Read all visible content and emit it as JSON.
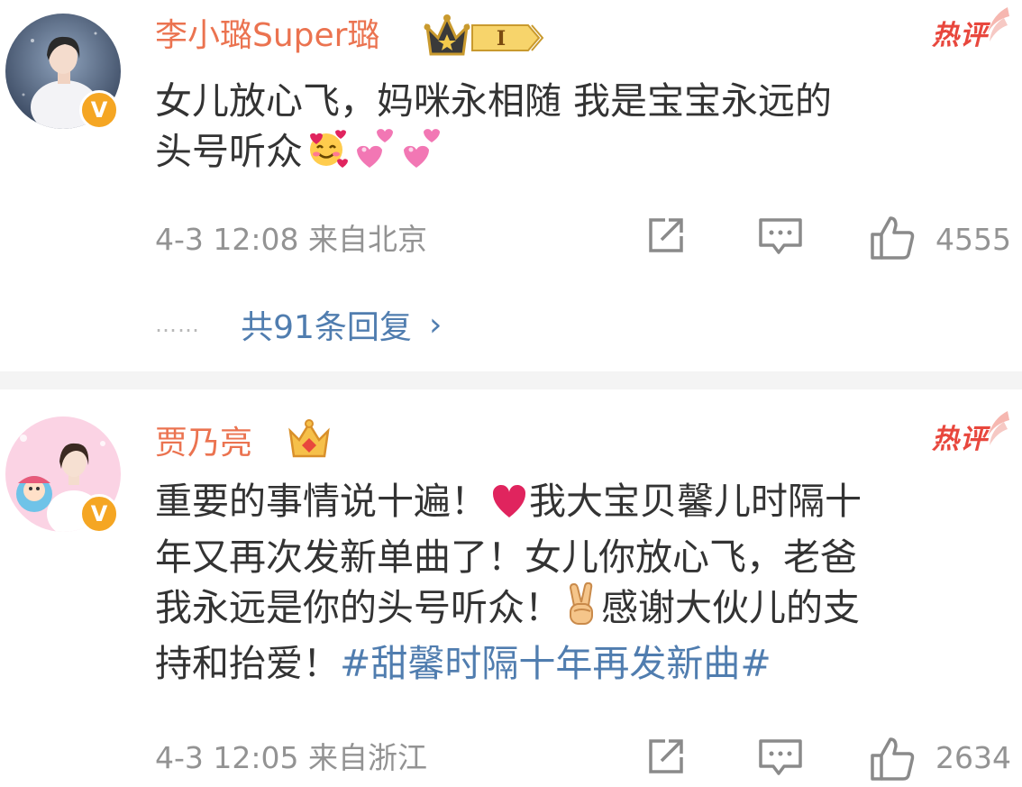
{
  "comments": [
    {
      "username": "李小璐Super璐",
      "badge_level": "I",
      "hot_label": "热评",
      "lines": [
        "女儿放心飞，妈咪永相随 我是宝宝永远的",
        "头号听众"
      ],
      "emojis": [
        "smiling-face-with-hearts-emoji",
        "revolving-hearts-emoji",
        "revolving-hearts-emoji"
      ],
      "timestamp": "4-3 12:08",
      "location": "来自北京",
      "likes": "4555",
      "replies_label": "共91条回复",
      "replies_dots": "……"
    },
    {
      "username": "贾乃亮",
      "hot_label": "热评",
      "line1_a": "重要的事情说十遍！",
      "line1_b": "我大宝贝馨儿时隔十",
      "line2": "年又再次发新单曲了！女儿你放心飞，老爸",
      "line3_a": "我永远是你的头号听众！",
      "line3_b": "感谢大伙儿的支",
      "line4_a": "持和抬爱！",
      "hashtag": "#甜馨时隔十年再发新曲#",
      "emojis": [
        "red-heart-emoji",
        "victory-hand-emoji"
      ],
      "timestamp": "4-3 12:05",
      "location": "来自浙江",
      "likes": "2634"
    }
  ],
  "verified_badge": "V",
  "colors": {
    "username": "#eb7350",
    "link": "#507daf",
    "hot": "#e8473d",
    "meta": "#939393",
    "badge": "#f5a623"
  }
}
